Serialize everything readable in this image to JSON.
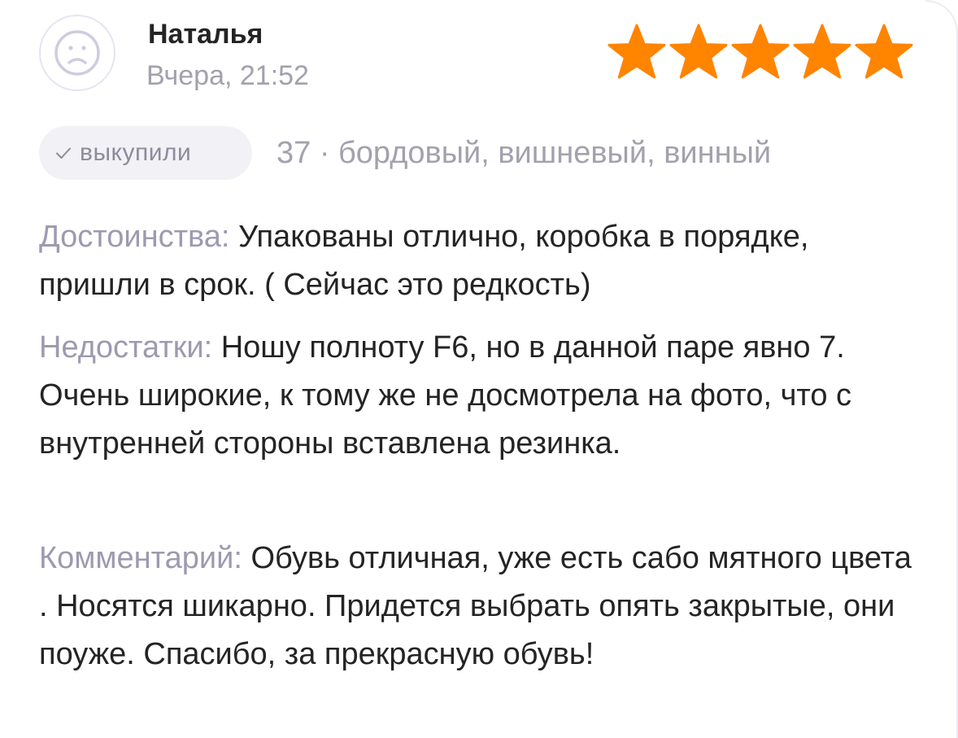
{
  "review": {
    "author": "Наталья",
    "date": "Вчера, 21:52",
    "rating": 5,
    "rating_max": 5,
    "star_color": "#ff8400",
    "badge": "выкупили",
    "variant": "37 · бордовый, вишневый, винный",
    "pros_label": "Достоинства:",
    "pros_text": "Упакованы отлично, коробка в порядке, пришли в срок. ( Сейчас это редкость)",
    "cons_label": "Недостатки:",
    "cons_text": "Ношу полноту F6, но в данной паре явно 7. Очень широкие, к тому же не досмотрела на фото, что с внутренней стороны вставлена резинка.",
    "comment_label": "Комментарий:",
    "comment_text": "Обувь отличная, уже есть сабо мятного цвета . Носятся шикарно. Придется выбрать опять закрытые, они поуже. Спасибо, за прекрасную обувь!"
  },
  "icons": {
    "avatar": "user-avatar-icon",
    "star": "star-icon",
    "check": "check-icon"
  }
}
